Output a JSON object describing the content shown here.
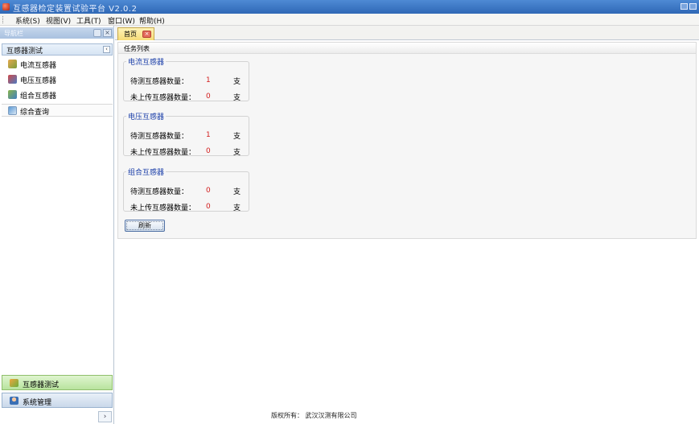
{
  "window": {
    "title": "互感器检定装置试验平台 V2.0.2"
  },
  "menubar": {
    "items": [
      {
        "label": "系统(S)"
      },
      {
        "label": "视图(V)"
      },
      {
        "label": "工具(T)"
      },
      {
        "label": "窗口(W)"
      },
      {
        "label": "帮助(H)"
      }
    ]
  },
  "nav": {
    "header": "导航栏",
    "section": "互感器测试",
    "items": [
      {
        "label": "电流互感器",
        "icon": "current-transformer-icon"
      },
      {
        "label": "电压互感器",
        "icon": "voltage-transformer-icon"
      },
      {
        "label": "组合互感器",
        "icon": "combined-transformer-icon"
      },
      {
        "label": "综合查询",
        "icon": "query-icon"
      }
    ],
    "bottom_tabs": [
      {
        "label": "互感器测试",
        "icon": "transformer-test-icon",
        "active": true
      },
      {
        "label": "系统管理",
        "icon": "admin-icon",
        "active": false
      }
    ]
  },
  "tabs": [
    {
      "label": "首页"
    }
  ],
  "panel": {
    "title": "任务列表",
    "groups": [
      {
        "title": "电流互感器",
        "rows": [
          {
            "label": "待测互感器数量：",
            "value": "1",
            "unit": "支"
          },
          {
            "label": "未上传互感器数量：",
            "value": "0",
            "unit": "支"
          }
        ]
      },
      {
        "title": "电压互感器",
        "rows": [
          {
            "label": "待测互感器数量：",
            "value": "1",
            "unit": "支"
          },
          {
            "label": "未上传互感器数量：",
            "value": "0",
            "unit": "支"
          }
        ]
      },
      {
        "title": "组合互感器",
        "rows": [
          {
            "label": "待测互感器数量：",
            "value": "0",
            "unit": "支"
          },
          {
            "label": "未上传互感器数量：",
            "value": "0",
            "unit": "支"
          }
        ]
      }
    ],
    "refresh_label": "刷新"
  },
  "footer": {
    "copyright": "版权所有： 武汉汉测有限公司"
  },
  "colors": {
    "titlebar": "#3a76c6",
    "group_title": "#1a3ea8",
    "value": "#d21e1e",
    "active_tab": "#b8e39e"
  }
}
